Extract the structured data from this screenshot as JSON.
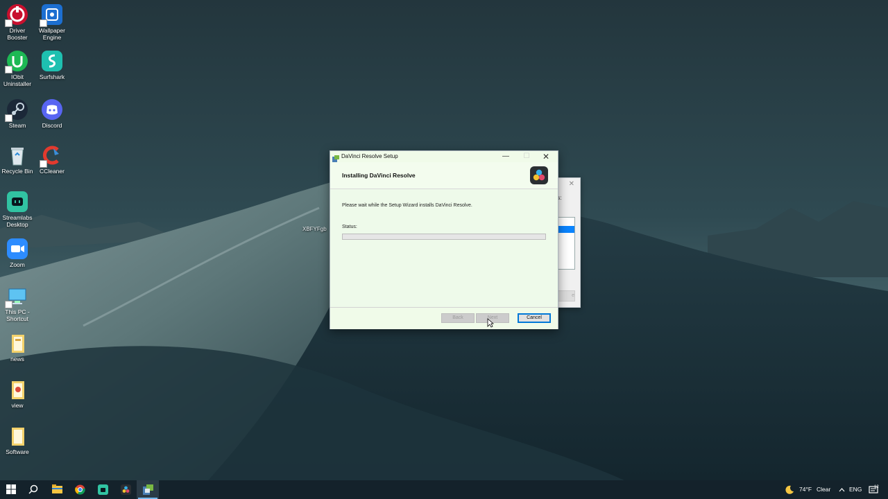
{
  "desktop": {
    "icons": [
      {
        "label": "Driver Booster",
        "icon": "driver-booster-icon"
      },
      {
        "label": "Wallpaper Engine",
        "icon": "wallpaper-engine-icon"
      },
      {
        "label": "IObit Uninstaller",
        "icon": "iobit-uninstaller-icon"
      },
      {
        "label": "Surfshark",
        "icon": "surfshark-icon"
      },
      {
        "label": "Steam",
        "icon": "steam-icon"
      },
      {
        "label": "Discord",
        "icon": "discord-icon"
      },
      {
        "label": "Recycle Bin",
        "icon": "recycle-bin-icon"
      },
      {
        "label": "CCleaner",
        "icon": "ccleaner-icon"
      },
      {
        "label": "Streamlabs Desktop",
        "icon": "streamlabs-icon"
      },
      {
        "label": "Zoom",
        "icon": "zoom-icon"
      },
      {
        "label": "This PC - Shortcut",
        "icon": "this-pc-icon"
      },
      {
        "label": "news",
        "icon": "folder-icon"
      },
      {
        "label": "view",
        "icon": "folder-icon"
      },
      {
        "label": "Software",
        "icon": "folder-icon"
      }
    ],
    "stray_text": "XBFYFgb"
  },
  "background_window": {
    "text": "ts:",
    "button_label": "e"
  },
  "dialog": {
    "title": "DaVinci Resolve Setup",
    "heading": "Installing DaVinci Resolve",
    "message": "Please wait while the Setup Wizard installs DaVinci Resolve.",
    "status_label": "Status:",
    "progress_fraction": 0,
    "buttons": {
      "back": "Back",
      "next": "Next",
      "cancel": "Cancel"
    }
  },
  "taskbar": {
    "pinned": [
      "start-icon",
      "search-icon",
      "file-explorer-icon",
      "chrome-icon",
      "streamlabs-icon",
      "davinci-resolve-icon",
      "setup-installer-icon"
    ],
    "weather_temp": "74°F",
    "weather_condition": "Clear",
    "language": "ENG",
    "notification_count": "12"
  },
  "colors": {
    "dialog_accent": "#0078d7",
    "taskbar_bg": "#14222b"
  }
}
